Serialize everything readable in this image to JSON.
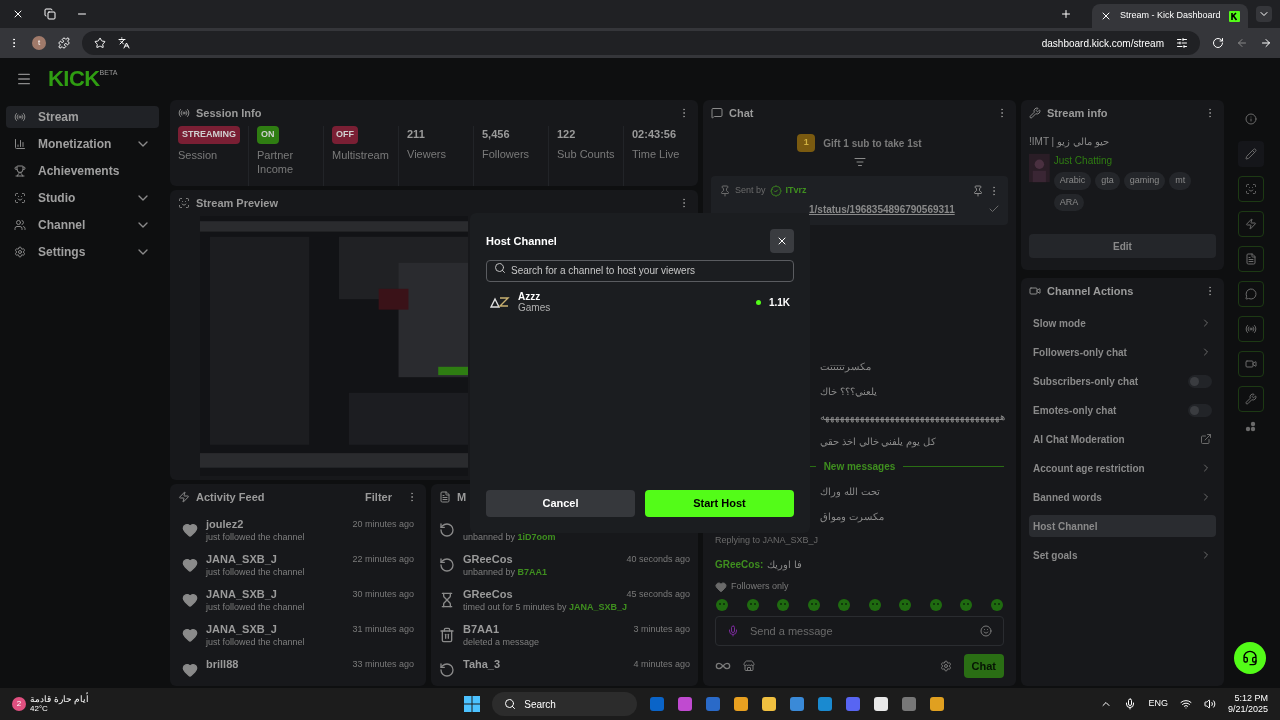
{
  "browser": {
    "tab_title": "Stream - Kick Dashboard",
    "url": "dashboard.kick.com/stream",
    "profile_letter": "t"
  },
  "logo": {
    "text": "KICK",
    "badge": "BETA"
  },
  "sidebar": {
    "items": [
      {
        "label": "Stream",
        "selected": true,
        "expandable": false
      },
      {
        "label": "Monetization",
        "selected": false,
        "expandable": true
      },
      {
        "label": "Achievements",
        "selected": false,
        "expandable": false
      },
      {
        "label": "Studio",
        "selected": false,
        "expandable": true
      },
      {
        "label": "Channel",
        "selected": false,
        "expandable": true
      },
      {
        "label": "Settings",
        "selected": false,
        "expandable": true
      }
    ]
  },
  "session_info": {
    "title": "Session Info",
    "stats": [
      {
        "kind": "badge",
        "value": "STREAMING",
        "label": "Session",
        "color": "#7a1f34"
      },
      {
        "kind": "badge",
        "value": "ON",
        "label": "Partner Income",
        "color": "#2f7d12"
      },
      {
        "kind": "badge",
        "value": "OFF",
        "label": "Multistream",
        "color": "#7a1f34"
      },
      {
        "kind": "number",
        "value": "211",
        "label": "Viewers"
      },
      {
        "kind": "number",
        "value": "5,456",
        "label": "Followers"
      },
      {
        "kind": "number",
        "value": "122",
        "label": "Sub Counts"
      },
      {
        "kind": "number",
        "value": "02:43:56",
        "label": "Time Live"
      }
    ]
  },
  "stream_preview": {
    "title": "Stream Preview",
    "kind": "picture"
  },
  "activity_feed": {
    "title": "Activity Feed",
    "filter": "Filter",
    "items": [
      {
        "name": "joulez2",
        "action": "just followed the channel",
        "time": "20 minutes ago"
      },
      {
        "name": "JANA_SXB_J",
        "action": "just followed the channel",
        "time": "22 minutes ago"
      },
      {
        "name": "JANA_SXB_J",
        "action": "just followed the channel",
        "time": "30 minutes ago"
      },
      {
        "name": "JANA_SXB_J",
        "action": "just followed the channel",
        "time": "31 minutes ago"
      },
      {
        "name": "brill88",
        "time": "33 minutes ago"
      }
    ]
  },
  "mod_log": {
    "title": "M",
    "items": [
      {
        "kind": "unban",
        "action": "unbanned by",
        "by": "1iD7oom"
      },
      {
        "kind": "unban",
        "name": "GReeCos",
        "action": "unbanned by",
        "by": "B7AA1",
        "time": "40 seconds ago"
      },
      {
        "kind": "timeout",
        "name": "GReeCos",
        "action": "timed out for 5 minutes by",
        "by": "JANA_SXB_J",
        "time": "45 seconds ago"
      },
      {
        "kind": "delete",
        "name": "B7AA1",
        "action": "deleted a message",
        "time": "3 minutes ago"
      },
      {
        "kind": "unban",
        "name": "Taha_3",
        "time": "4 minutes ago"
      }
    ]
  },
  "chat": {
    "title": "Chat",
    "gift_rank": "1",
    "gift_text": "Gift 1 sub to take 1st",
    "pinned": {
      "sent_by": "Sent by",
      "user": "ITvrz",
      "link": "1/status/1968354896790569311"
    },
    "messages": [
      {
        "kind": "text",
        "text": "مكسرتتتتتت"
      },
      {
        "kind": "text",
        "text": "يلعني؟؟؟ خاك"
      },
      {
        "kind": "text",
        "text": "ههههههههههههههههههههههههههههههههههههه"
      },
      {
        "kind": "text",
        "text": "كل يوم يلفني خالي اخذ حقي"
      },
      {
        "kind": "divider",
        "text": "New messages"
      },
      {
        "kind": "text",
        "text": "تحت الله وراك"
      },
      {
        "kind": "text",
        "text": "مكسرت ومواق"
      },
      {
        "kind": "reply",
        "text": "Replying to JANA_SXB_J"
      },
      {
        "kind": "user",
        "user": "GReeCos:",
        "text": "فا اوريك"
      }
    ],
    "mode": "Followers only",
    "placeholder": "Send a message",
    "send": "Chat"
  },
  "stream_info": {
    "title": "Stream info",
    "stream_title": "!IMT | حيو مالي زيو",
    "category": "Just Chatting",
    "tags": [
      "Arabic",
      "gta",
      "gaming",
      "mt",
      "ARA"
    ],
    "edit": "Edit"
  },
  "channel_actions": {
    "title": "Channel Actions",
    "items": [
      {
        "label": "Slow mode",
        "kind": "chevron",
        "selected": false
      },
      {
        "label": "Followers-only chat",
        "kind": "chevron",
        "selected": false
      },
      {
        "label": "Subscribers-only chat",
        "kind": "toggle",
        "on": false,
        "selected": false
      },
      {
        "label": "Emotes-only chat",
        "kind": "toggle",
        "on": false,
        "selected": false
      },
      {
        "label": "AI Chat Moderation",
        "kind": "external",
        "selected": false
      },
      {
        "label": "Account age restriction",
        "kind": "chevron",
        "selected": false
      },
      {
        "label": "Banned words",
        "kind": "chevron",
        "selected": false
      },
      {
        "label": "Host Channel",
        "kind": "plain",
        "selected": true
      },
      {
        "label": "Set goals",
        "kind": "chevron",
        "selected": false
      }
    ]
  },
  "host_dialog": {
    "title": "Host Channel",
    "placeholder": "Search for a channel to host your viewers",
    "results": [
      {
        "name": "Azzz",
        "category": "Games",
        "viewers": "1.1K",
        "live": true
      }
    ],
    "cancel": "Cancel",
    "confirm": "Start Host"
  },
  "taskbar": {
    "weather_text": "أيام حارة قادمة",
    "temperature": "42°C",
    "weather_badge": "2",
    "search": "Search",
    "language": "ENG",
    "time": "5:12 PM",
    "date": "9/21/2025"
  }
}
